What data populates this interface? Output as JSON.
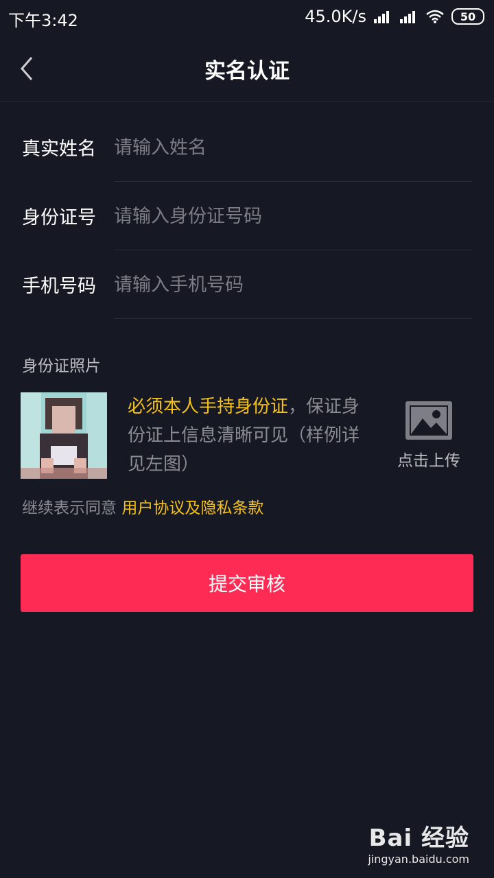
{
  "status_bar": {
    "time": "下午3:42",
    "speed": "45.0K/s",
    "battery": "50"
  },
  "nav": {
    "back_icon": "chevron-left-icon",
    "title": "实名认证"
  },
  "form": {
    "fields": [
      {
        "label": "真实姓名",
        "placeholder": "请输入姓名"
      },
      {
        "label": "身份证号",
        "placeholder": "请输入身份证号码"
      },
      {
        "label": "手机号码",
        "placeholder": "请输入手机号码"
      }
    ]
  },
  "photo": {
    "section_title": "身份证照片",
    "highlight": "必须本人手持身份证",
    "description": "，保证身份证上信息清晰可见（样例详见左图）",
    "upload_label": "点击上传",
    "upload_icon": "image-icon"
  },
  "agreement": {
    "prefix": "继续表示同意 ",
    "link": "用户协议及隐私条款"
  },
  "submit_label": "提交审核",
  "watermark": {
    "logo": "Bai 经验",
    "url": "jingyan.baidu.com"
  },
  "colors": {
    "background": "#161823",
    "accent": "#fe2c55",
    "highlight": "#f6c218"
  }
}
